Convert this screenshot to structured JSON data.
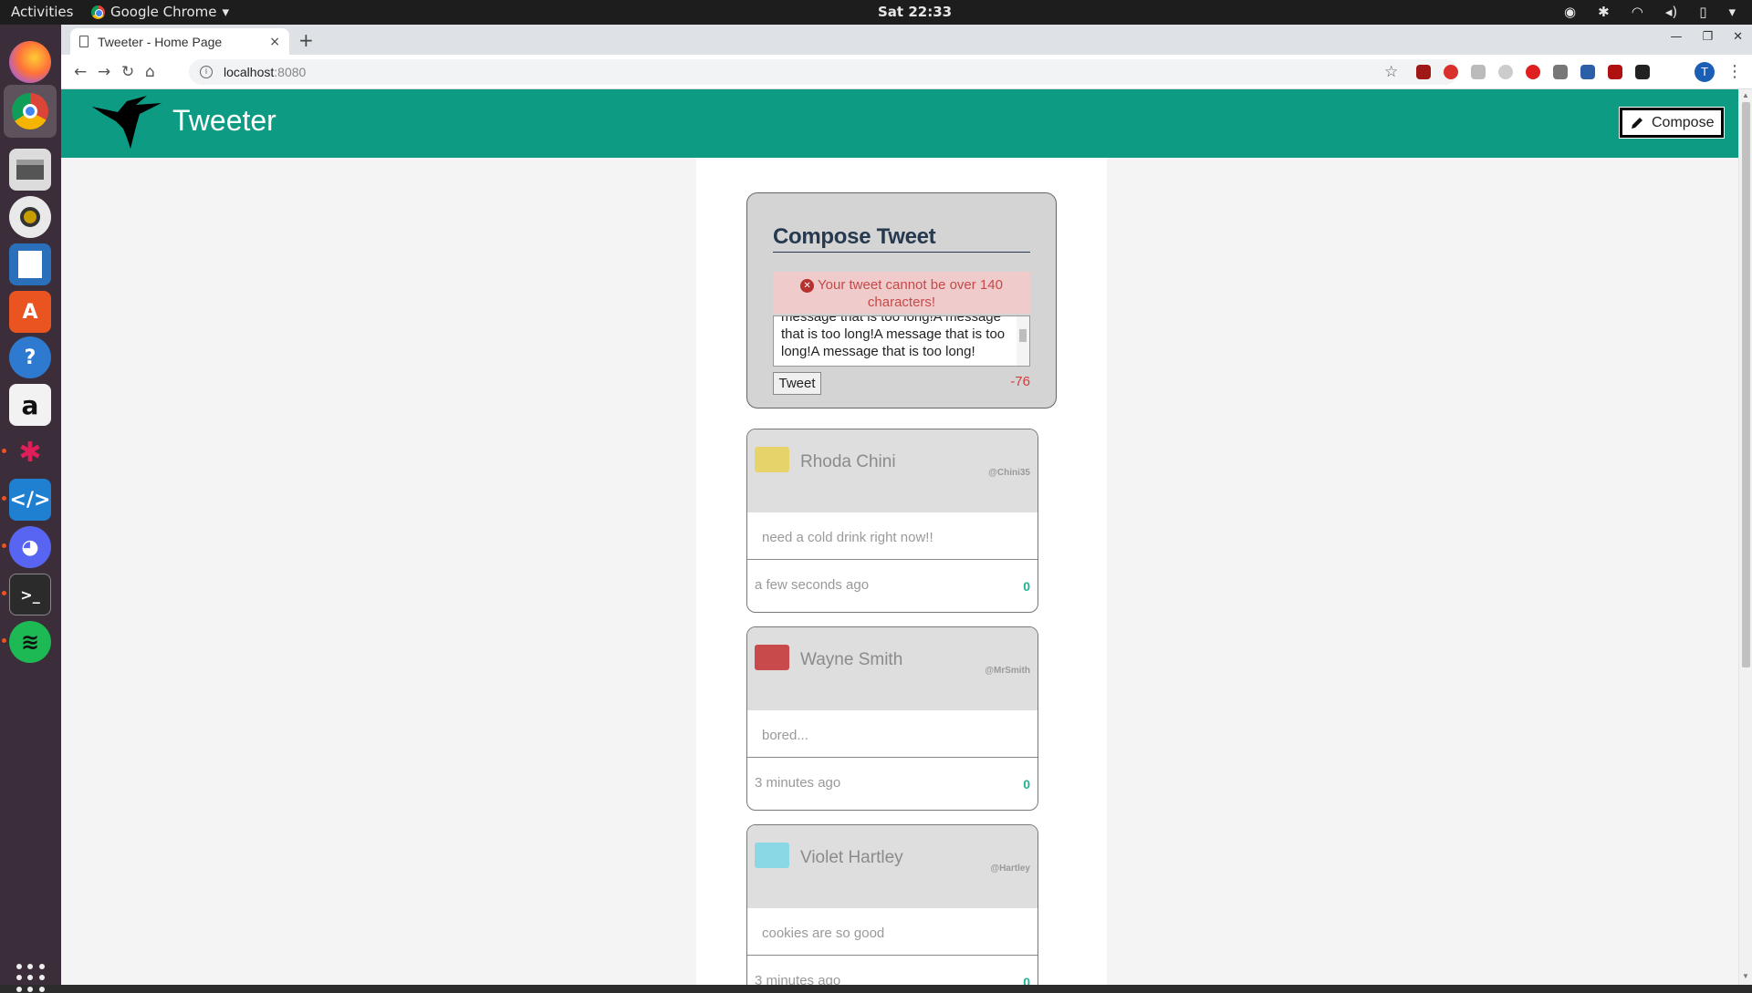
{
  "os": {
    "activities_label": "Activities",
    "app_menu_label": "Google Chrome",
    "app_menu_arrow": "▾",
    "clock": "Sat 22:33"
  },
  "browser": {
    "tab_title": "Tweeter - Home Page",
    "tab_close": "×",
    "new_tab": "+",
    "url_host": "localhost",
    "url_port": ":8080"
  },
  "site": {
    "title": "Tweeter",
    "compose_label": "Compose",
    "brand_color": "#0e9b84"
  },
  "compose": {
    "heading": "Compose Tweet",
    "error_text": "Your tweet cannot be over 140 characters!",
    "textarea_value": "message that is too long!A message that is too long!A message that is too long!A message that is too long!",
    "tweet_button": "Tweet",
    "counter": "-76"
  },
  "tweets": [
    {
      "name": "Rhoda Chini",
      "handle": "@Chini35",
      "text": "need a cold drink right now!!",
      "time": "a few seconds ago",
      "likes": "0",
      "avatar_color": "#e6d36a"
    },
    {
      "name": "Wayne Smith",
      "handle": "@MrSmith",
      "text": "bored...",
      "time": "3 minutes ago",
      "likes": "0",
      "avatar_color": "#c94a4a"
    },
    {
      "name": "Violet Hartley",
      "handle": "@Hartley",
      "text": "cookies are so good",
      "time": "3 minutes ago",
      "likes": "0",
      "avatar_color": "#8ad7e6"
    }
  ]
}
